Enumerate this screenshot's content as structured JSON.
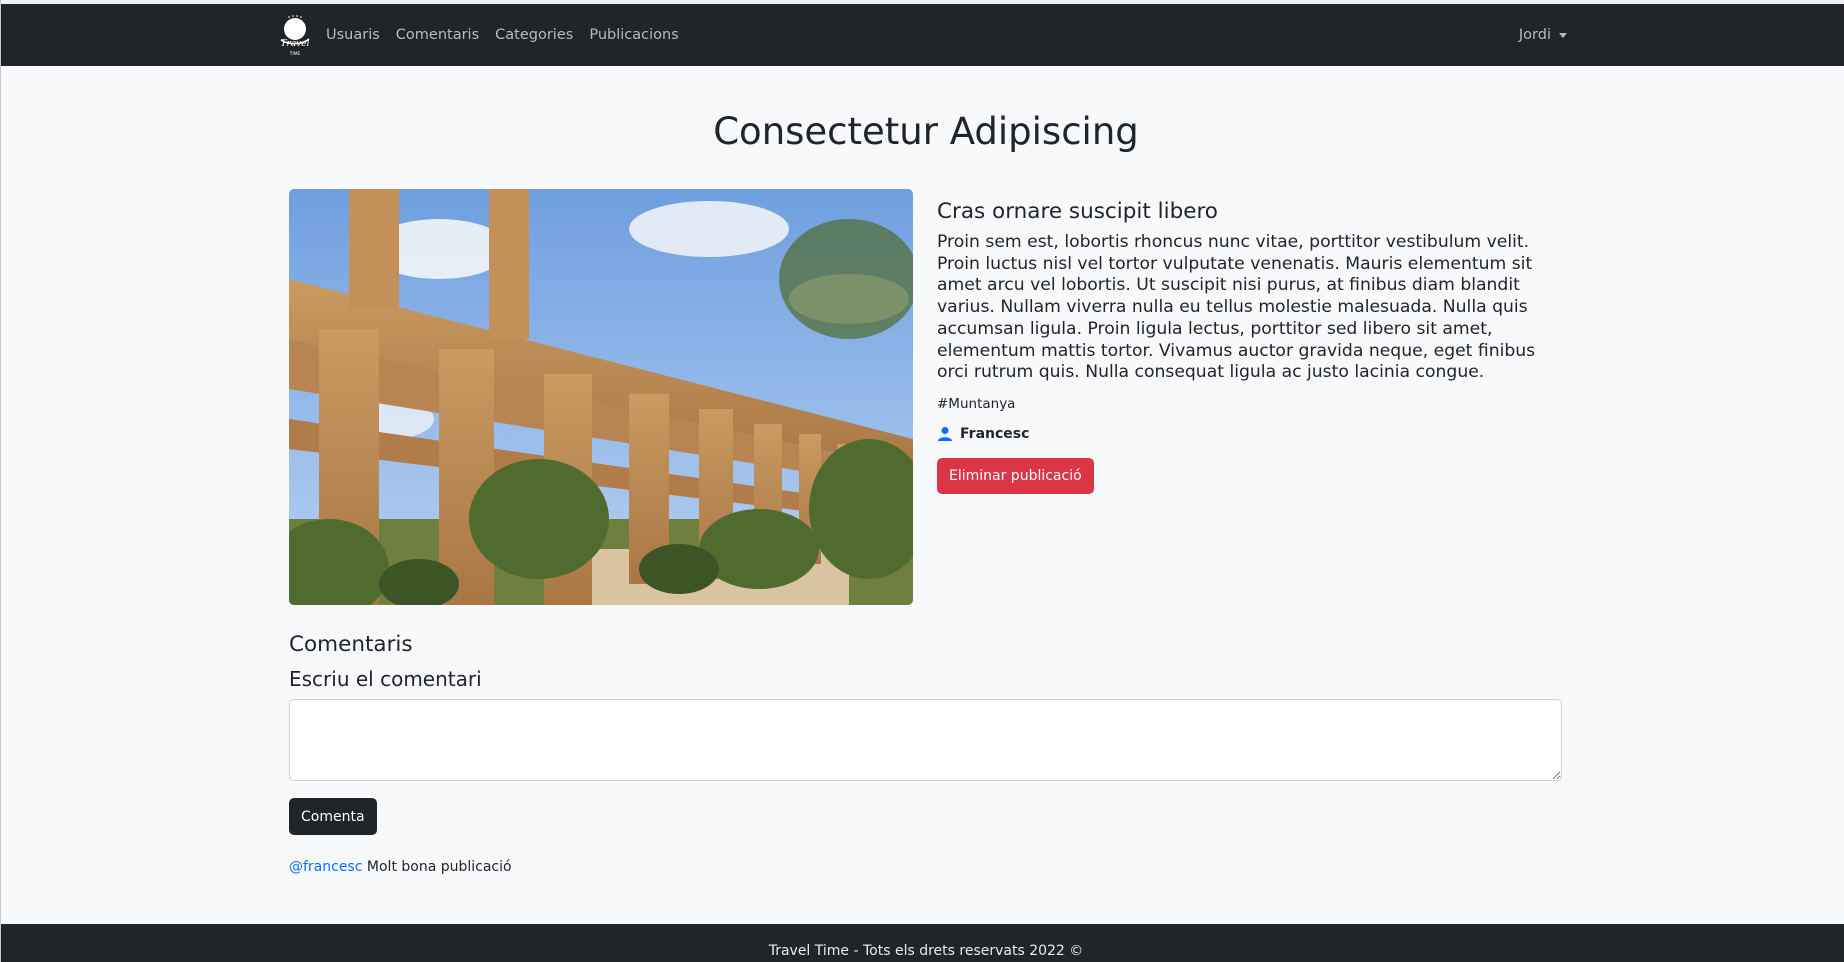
{
  "navbar": {
    "logo_text": "Travel TIME",
    "links": [
      "Usuaris",
      "Comentaris",
      "Categories",
      "Publicacions"
    ],
    "user": "Jordi"
  },
  "post": {
    "title": "Consectetur Adipiscing",
    "image_alt": "Aqueducte romà de pedra amb arcs",
    "subtitle": "Cras ornare suscipit libero",
    "body": "Proin sem est, lobortis rhoncus nunc vitae, porttitor vestibulum velit. Proin luctus nisl vel tortor vulputate venenatis. Mauris elementum sit amet arcu vel lobortis. Ut suscipit nisi purus, at finibus diam blandit varius. Nullam viverra nulla eu tellus molestie malesuada. Nulla quis accumsan ligula. Proin ligula lectus, porttitor sed libero sit amet, elementum mattis tortor. Vivamus auctor gravida neque, eget finibus orci rutrum quis. Nulla consequat ligula ac justo lacinia congue.",
    "tag": "#Muntanya",
    "author": "Francesc",
    "delete_label": "Eliminar publicació"
  },
  "comments": {
    "title": "Comentaris",
    "form_label": "Escriu el comentari",
    "textarea_value": "",
    "submit_label": "Comenta",
    "items": [
      {
        "user": "@francesc",
        "text": "Molt bona publicació"
      }
    ]
  },
  "footer": {
    "text": "Travel Time - Tots els drets reservats 2022 ©"
  },
  "colors": {
    "navbar_bg": "#212529",
    "danger": "#dc3545",
    "link": "#0d6efd",
    "page_bg": "#f8f9fa"
  },
  "icons": {
    "author": "person-icon",
    "dropdown": "caret-down-icon"
  }
}
